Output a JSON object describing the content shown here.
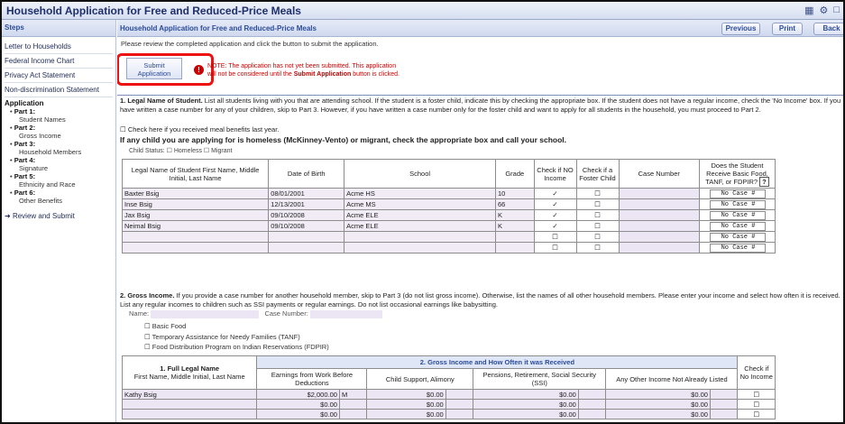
{
  "app_title": "Household Application for Free and Reduced-Price Meals",
  "sidebar": {
    "heading": "Steps",
    "links": [
      "Letter to Households",
      "Federal Income Chart",
      "Privacy Act Statement",
      "Non-discrimination Statement"
    ],
    "application_label": "Application",
    "parts": [
      {
        "part": "Part 1:",
        "name": "Student Names"
      },
      {
        "part": "Part 2:",
        "name": "Gross Income"
      },
      {
        "part": "Part 3:",
        "name": "Household Members"
      },
      {
        "part": "Part 4:",
        "name": "Signature"
      },
      {
        "part": "Part 5:",
        "name": "Ethnicity and Race"
      },
      {
        "part": "Part 6:",
        "name": "Other Benefits"
      }
    ],
    "review": "Review and Submit"
  },
  "main": {
    "title": "Household Application for Free and Reduced-Price Meals",
    "nav": {
      "previous": "Previous",
      "print": "Print",
      "back": "Back"
    },
    "intro": "Please review the completed application and click the button to submit the application.",
    "submit_label_1": "Submit",
    "submit_label_2": "Application",
    "warning_1": "NOTE: The application has not yet been submitted. This application",
    "warning_2_pre": "will not be considered until the ",
    "warning_2_bold": "Submit Application",
    "warning_2_post": " button is clicked."
  },
  "section1": {
    "lead": "1. Legal Name of Student.",
    "text": " List all students living with you that are attending school. If the student is a foster child, indicate this by checking the appropriate box. If the student does not have a regular income, check the 'No Income' box. If you have written a case number for any of your children, skip to Part 3. However, if you have written a case number only for the foster child and want to apply for all students in the household, you must proceed to Part 2.",
    "checkbox_meal": "Check here if you received meal benefits last year.",
    "homeless": "If any child you are applying for is homeless (McKinney-Vento) or migrant, check the appropriate box and call your school.",
    "child_status": "Child Status: ☐ Homeless ☐ Migrant",
    "headers": {
      "name": "Legal Name of Student First Name, Middle Initial, Last Name",
      "dob": "Date of Birth",
      "school": "School",
      "grade": "Grade",
      "no_income": "Check if NO Income",
      "foster": "Check if a Foster Child",
      "case": "Case Number",
      "benefits": "Does the Student Receive Basic Food, TANF, or FDPIR?"
    },
    "rows": [
      {
        "name": "Baxter Bsig",
        "dob": "08/01/2001",
        "school": "Acme HS",
        "grade": "10",
        "no_income": "✓",
        "foster": "☐",
        "case": "",
        "benefit": "No Case #"
      },
      {
        "name": "Inse Bsig",
        "dob": "12/13/2001",
        "school": "Acme MS",
        "grade": "66",
        "no_income": "✓",
        "foster": "☐",
        "case": "",
        "benefit": "No Case #"
      },
      {
        "name": "Jax Bsig",
        "dob": "09/10/2008",
        "school": "Acme ELE",
        "grade": "K",
        "no_income": "✓",
        "foster": "☐",
        "case": "",
        "benefit": "No Case #"
      },
      {
        "name": "Neimal Bsig",
        "dob": "09/10/2008",
        "school": "Acme ELE",
        "grade": "K",
        "no_income": "✓",
        "foster": "☐",
        "case": "",
        "benefit": "No Case #"
      },
      {
        "name": "",
        "dob": "",
        "school": "",
        "grade": "",
        "no_income": "☐",
        "foster": "☐",
        "case": "",
        "benefit": "No Case #"
      },
      {
        "name": "",
        "dob": "",
        "school": "",
        "grade": "",
        "no_income": "☐",
        "foster": "☐",
        "case": "",
        "benefit": "No Case #"
      }
    ]
  },
  "section2": {
    "lead": "2. Gross Income.",
    "text": " If you provide a case number for another household member, skip to Part 3 (do not list gross income). Otherwise, list the names of all other household members. Please enter your income and select how often it is received. List any regular incomes to children such as SSI payments or regular earnings. Do not list occasional earnings like babysitting.",
    "name_label": "Name:",
    "case_label": "Case Number:",
    "programs": [
      "☐ Basic Food",
      "☐ Temporary Assistance for Needy Families (TANF)",
      "☐ Food Distribution Program on Indian Reservations (FDPIR)"
    ],
    "band_left": "1. Full Legal Name",
    "band_left_sub": "First Name, Middle Initial, Last Name",
    "band_right": "2. Gross Income and How Often it was Received",
    "headers": [
      "Earnings from Work Before Deductions",
      "Child Support, Alimony",
      "Pensions, Retirement, Social Security (SSI)",
      "Any Other Income Not Already Listed",
      "Check if No Income"
    ],
    "rows": [
      {
        "name": "Kathy Bsig",
        "earn": "$2,000.00",
        "earn_freq": "M",
        "child": "$0.00",
        "pension": "$0.00",
        "other": "$0.00",
        "none": "☐"
      },
      {
        "name": "",
        "earn": "$0.00",
        "earn_freq": "",
        "child": "$0.00",
        "pension": "$0.00",
        "other": "$0.00",
        "none": "☐"
      },
      {
        "name": "",
        "earn": "$0.00",
        "earn_freq": "",
        "child": "$0.00",
        "pension": "$0.00",
        "other": "$0.00",
        "none": "☐"
      }
    ]
  },
  "icons": [
    "calendar-icon",
    "settings-icon",
    "window-icon"
  ],
  "accent_color": "#2b4b9a",
  "warning_color": "#cc0000"
}
